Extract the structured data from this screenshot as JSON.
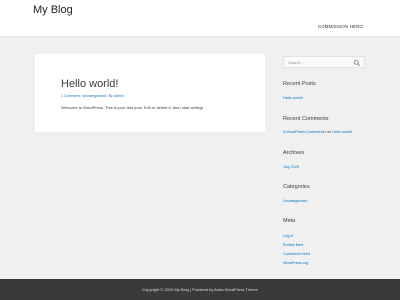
{
  "header": {
    "site_title": "My Blog",
    "menu_item": "COMMISSION HERO"
  },
  "post": {
    "title": "Hello world!",
    "meta_comment": "1 Comment",
    "meta_category": "Uncategorized",
    "meta_by": "By",
    "meta_author": "admin",
    "separator": "/",
    "excerpt": "Welcome to WordPress. This is your first post. Edit or delete it, then start writing!"
  },
  "sidebar": {
    "search_placeholder": "Search ...",
    "recent_posts": {
      "title": "Recent Posts",
      "items": [
        "Hello world!"
      ]
    },
    "recent_comments": {
      "title": "Recent Comments",
      "author": "A WordPress Commenter",
      "on_text": "on",
      "post": "Hello world!"
    },
    "archives": {
      "title": "Archives",
      "items": [
        "July 2020"
      ]
    },
    "categories": {
      "title": "Categories",
      "items": [
        "Uncategorized"
      ]
    },
    "meta": {
      "title": "Meta",
      "items": [
        "Log in",
        "Entries feed",
        "Comments feed",
        "WordPress.org"
      ]
    }
  },
  "footer": {
    "text": "Copyright © 2020 My Blog | Powered by Astra WordPress Theme"
  },
  "colors": {
    "link": "#0274be",
    "footer_bg": "#3a3a3a",
    "page_bg": "#f0f0f0"
  },
  "icons": [
    "search-icon"
  ]
}
